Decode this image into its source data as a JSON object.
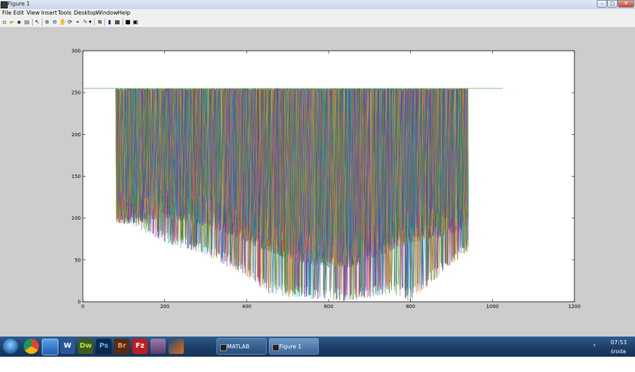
{
  "window": {
    "title": "Figure 1",
    "controls": [
      "–",
      "□",
      "✕"
    ]
  },
  "menu": [
    "File",
    "Edit",
    "View",
    "Insert",
    "Tools",
    "Desktop",
    "Window",
    "Help"
  ],
  "toolbar": {
    "icons": [
      "new-figure-icon",
      "open-file-icon",
      "save-icon",
      "print-icon",
      "edit-plot-icon",
      "zoom-in-icon",
      "zoom-out-icon",
      "pan-icon",
      "rotate-3d-icon",
      "data-cursor-icon",
      "brush-icon",
      "link-plot-icon",
      "colorbar-icon",
      "legend-icon",
      "hide-plot-tools-icon",
      "show-plot-tools-icon"
    ]
  },
  "chart_data": {
    "type": "line",
    "title": "",
    "xlabel": "",
    "ylabel": "",
    "xlim": [
      0,
      1200
    ],
    "ylim": [
      0,
      300
    ],
    "xticks": [
      "0",
      "200",
      "400",
      "600",
      "800",
      "1000",
      "1200"
    ],
    "yticks": [
      "0",
      "50",
      "100",
      "150",
      "200",
      "250",
      "300"
    ],
    "grid": false,
    "legend": "none",
    "series_description": "dense overlay of many multicolored line series spanning x≈80–940, values between ≈0 and 255",
    "series": [
      {
        "x": [
          0,
          1025
        ],
        "values": [
          255,
          255
        ],
        "color": "#7fbf7f"
      }
    ],
    "bundle": {
      "x_range": [
        80,
        940
      ],
      "y_top": 255,
      "envelope_x": [
        80,
        100,
        200,
        300,
        400,
        450,
        500,
        600,
        650,
        700,
        750,
        800,
        900,
        940
      ],
      "envelope_low": [
        98,
        96,
        70,
        55,
        30,
        10,
        5,
        2,
        0,
        5,
        10,
        0,
        45,
        60
      ],
      "envelope_body": [
        115,
        112,
        120,
        110,
        90,
        80,
        70,
        60,
        60,
        70,
        80,
        90,
        100,
        110
      ]
    }
  },
  "taskbar": {
    "apps": [
      {
        "name": "start-button",
        "label": ""
      },
      {
        "name": "chrome-app-icon",
        "label": ""
      },
      {
        "name": "desktop-app-icon",
        "label": ""
      },
      {
        "name": "word-app-icon",
        "label": "W"
      },
      {
        "name": "dreamweaver-app-icon",
        "label": "Dw"
      },
      {
        "name": "photoshop-app-icon",
        "label": "Ps"
      },
      {
        "name": "bridge-app-icon",
        "label": "Br"
      },
      {
        "name": "filezilla-app-icon",
        "label": "Fz"
      },
      {
        "name": "virtualbox-app-icon",
        "label": ""
      },
      {
        "name": "matlab-app-icon",
        "label": ""
      }
    ],
    "windows": [
      {
        "label": "MATLAB  R20..."
      },
      {
        "label": "Figure 1"
      }
    ],
    "clock": {
      "time": "07:53",
      "day": "środa"
    }
  },
  "colors": {
    "figure_bg": "#cdcdcd",
    "axes_bg": "#ffffff",
    "reference_line": "#7fbf7f"
  }
}
